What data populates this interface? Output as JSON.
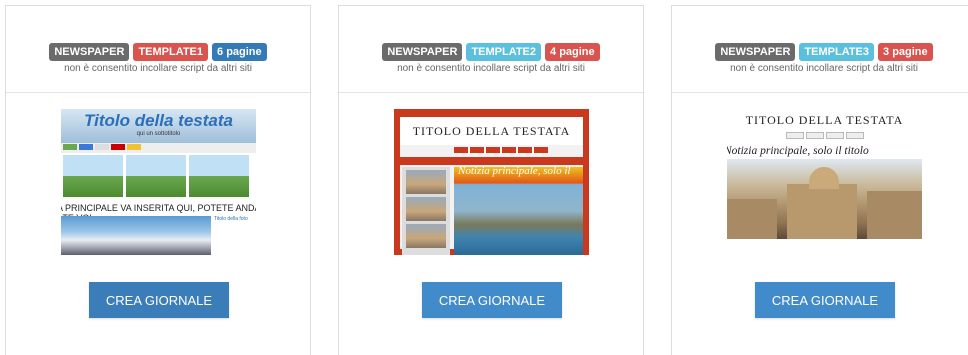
{
  "common": {
    "badge_newspaper": "NEWSPAPER",
    "note": "non è consentito incollare script da altri siti",
    "button_label": "CREA GIORNALE"
  },
  "cards": [
    {
      "template": "TEMPLATE1",
      "pages": "6 pagine",
      "thumb": {
        "title": "Titolo della testata",
        "subtitle": "qui un sottotitolo",
        "body": "A PRINCIPALE VA INSERITA QUI, POTETE ANDARE ANCHE A CAP",
        "body2": "ATE VOI.",
        "side": "Titolo della foto"
      }
    },
    {
      "template": "TEMPLATE2",
      "pages": "4 pagine",
      "thumb": {
        "title": "TITOLO DELLA TESTATA",
        "caption": "Notizia principale, solo il"
      }
    },
    {
      "template": "TEMPLATE3",
      "pages": "3 pagine",
      "thumb": {
        "title": "TITOLO DELLA TESTATA",
        "lead": "Notizia principale, solo il titolo"
      }
    }
  ]
}
